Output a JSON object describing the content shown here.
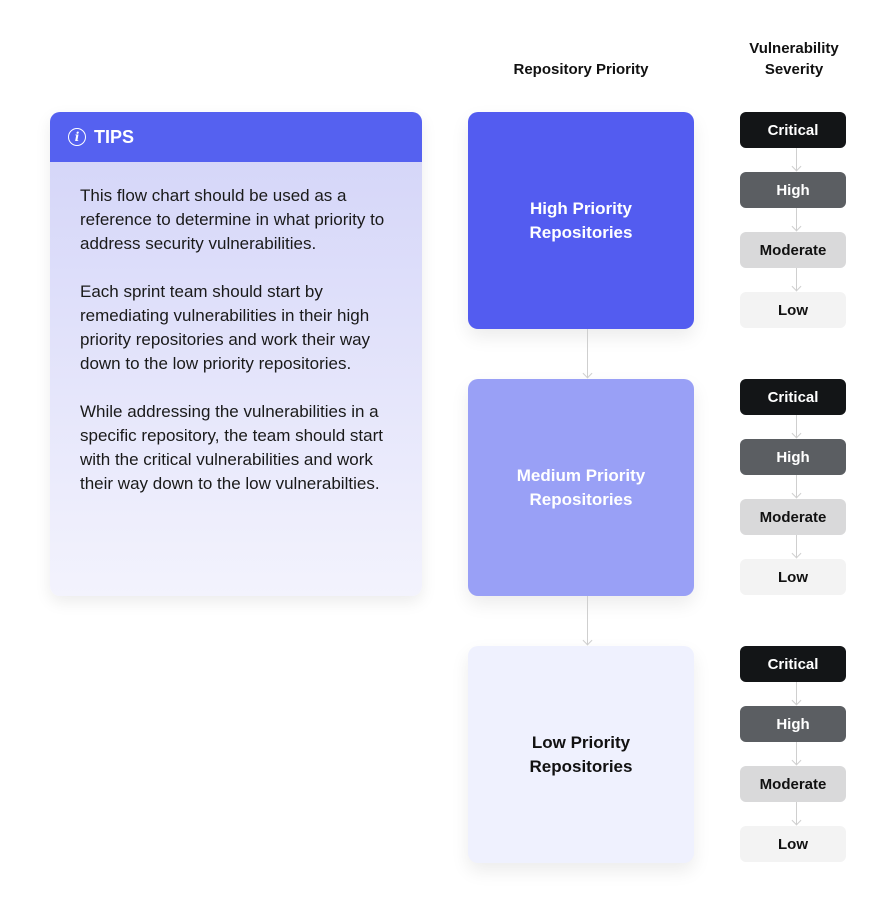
{
  "headers": {
    "repository_priority": "Repository Priority",
    "vulnerability_severity": "Vulnerability Severity"
  },
  "tips": {
    "icon": "info-icon",
    "title": "TIPS",
    "paragraphs": [
      "This flow chart should be used as a reference to determine in what priority to address security vulnerabilities.",
      "Each sprint team should start by remediating vulnerabilities in their high priority repositories and work their way down to the low priority repositories.",
      "While addressing the vulnerabilities in a specific repository, the team should start with the critical vulnerabilities and work their way down to the low vulnerabilties."
    ]
  },
  "priorities": [
    {
      "label": "High Priority Repositories",
      "color": "#535cf0"
    },
    {
      "label": "Medium Priority Repositories",
      "color": "#99a0f6"
    },
    {
      "label": "Low Priority Repositories",
      "color": "#eff1fe"
    }
  ],
  "severities": [
    {
      "label": "Critical",
      "color": "#131517"
    },
    {
      "label": "High",
      "color": "#5b5e62"
    },
    {
      "label": "Moderate",
      "color": "#d9d9da"
    },
    {
      "label": "Low",
      "color": "#f3f3f3"
    }
  ],
  "colors": {
    "accent": "#5561f0"
  }
}
